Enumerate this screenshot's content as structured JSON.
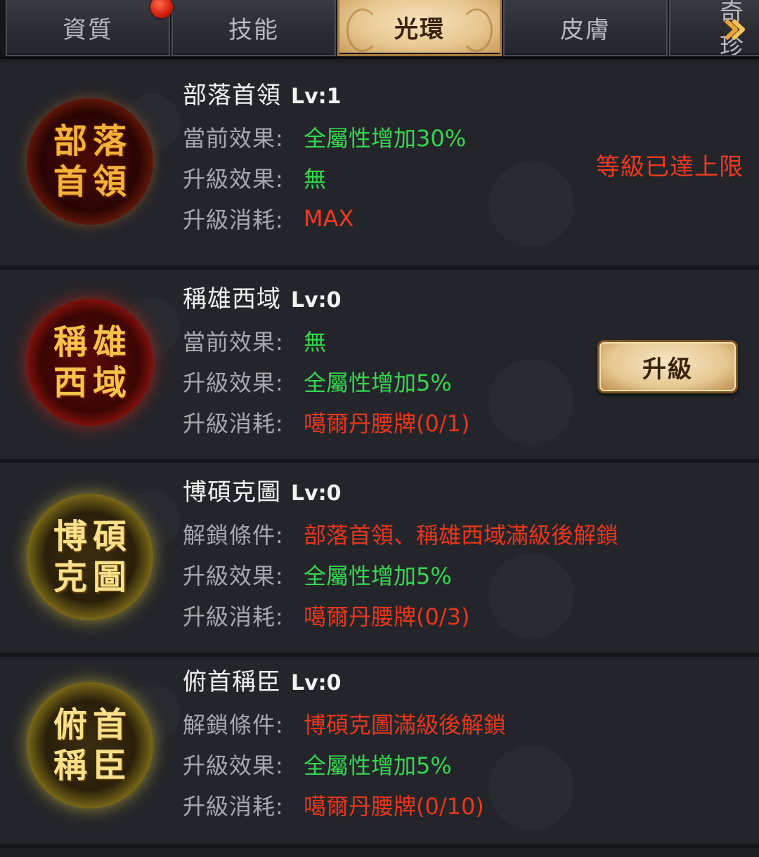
{
  "tabs": [
    {
      "label": "資質"
    },
    {
      "label": "技能"
    },
    {
      "label": "光環"
    },
    {
      "label": "皮膚"
    },
    {
      "label": "奇珍"
    }
  ],
  "active_tab": "光環",
  "auras": [
    {
      "emblem": [
        "部",
        "落",
        "首",
        "領"
      ],
      "name": "部落首領",
      "level": "Lv:1",
      "lines": [
        {
          "label": "當前效果:",
          "value": "全屬性增加30%"
        },
        {
          "label": "升級效果:",
          "value": "無"
        },
        {
          "label": "升級消耗:",
          "value": "MAX"
        }
      ],
      "status": "等級已達上限"
    },
    {
      "emblem": [
        "稱",
        "雄",
        "西",
        "域"
      ],
      "name": "稱雄西域",
      "level": "Lv:0",
      "lines": [
        {
          "label": "當前效果:",
          "value": "無"
        },
        {
          "label": "升級效果:",
          "value": "全屬性增加5%"
        },
        {
          "label": "升級消耗:",
          "value": "噶爾丹腰牌(0/1)"
        }
      ],
      "button": "升級"
    },
    {
      "emblem": [
        "博",
        "碩",
        "克",
        "圖"
      ],
      "name": "博碩克圖",
      "level": "Lv:0",
      "lines": [
        {
          "label": "解鎖條件:",
          "value": "部落首領、稱雄西域滿級後解鎖"
        },
        {
          "label": "升級效果:",
          "value": "全屬性增加5%"
        },
        {
          "label": "升級消耗:",
          "value": "噶爾丹腰牌(0/3)"
        }
      ]
    },
    {
      "emblem": [
        "俯",
        "首",
        "稱",
        "臣"
      ],
      "name": "俯首稱臣",
      "level": "Lv:0",
      "lines": [
        {
          "label": "解鎖條件:",
          "value": "博碩克圖滿級後解鎖"
        },
        {
          "label": "升級效果:",
          "value": "全屬性增加5%"
        },
        {
          "label": "升級消耗:",
          "value": "噶爾丹腰牌(0/10)"
        }
      ]
    }
  ],
  "colors": {
    "effect_green": "#35d650",
    "cost_red": "#f0391e",
    "tab_active": "#e8c891",
    "background": "#24252a"
  }
}
